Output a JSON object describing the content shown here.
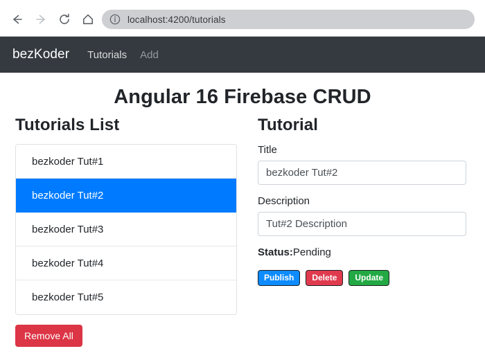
{
  "browser": {
    "back_icon": "back-arrow-icon",
    "forward_icon": "forward-arrow-icon",
    "reload_icon": "reload-icon",
    "home_icon": "home-icon",
    "site_info_icon": "site-info-icon",
    "url": "localhost:4200/tutorials"
  },
  "navbar": {
    "brand": "bezKoder",
    "links": [
      {
        "label": "Tutorials",
        "muted": false
      },
      {
        "label": "Add",
        "muted": true
      }
    ]
  },
  "page": {
    "title": "Angular 16 Firebase CRUD"
  },
  "tutorials_list": {
    "heading": "Tutorials List",
    "items": [
      {
        "label": "bezkoder Tut#1",
        "active": false
      },
      {
        "label": "bezkoder Tut#2",
        "active": true
      },
      {
        "label": "bezkoder Tut#3",
        "active": false
      },
      {
        "label": "bezkoder Tut#4",
        "active": false
      },
      {
        "label": "bezkoder Tut#5",
        "active": false
      }
    ],
    "remove_all_label": "Remove All"
  },
  "tutorial_detail": {
    "heading": "Tutorial",
    "title_label": "Title",
    "title_value": "bezkoder Tut#2",
    "title_placeholder": "Title",
    "description_label": "Description",
    "description_value": "Tut#2 Description",
    "description_placeholder": "Description",
    "status_label": "Status:",
    "status_value": "Pending",
    "buttons": {
      "publish": "Publish",
      "delete": "Delete",
      "update": "Update"
    }
  },
  "colors": {
    "navbar_bg": "#343a40",
    "primary": "#007bff",
    "danger": "#dc3545",
    "success": "#22a944",
    "publish_blue": "#0d8bff",
    "delete_red": "#e03a4e"
  }
}
